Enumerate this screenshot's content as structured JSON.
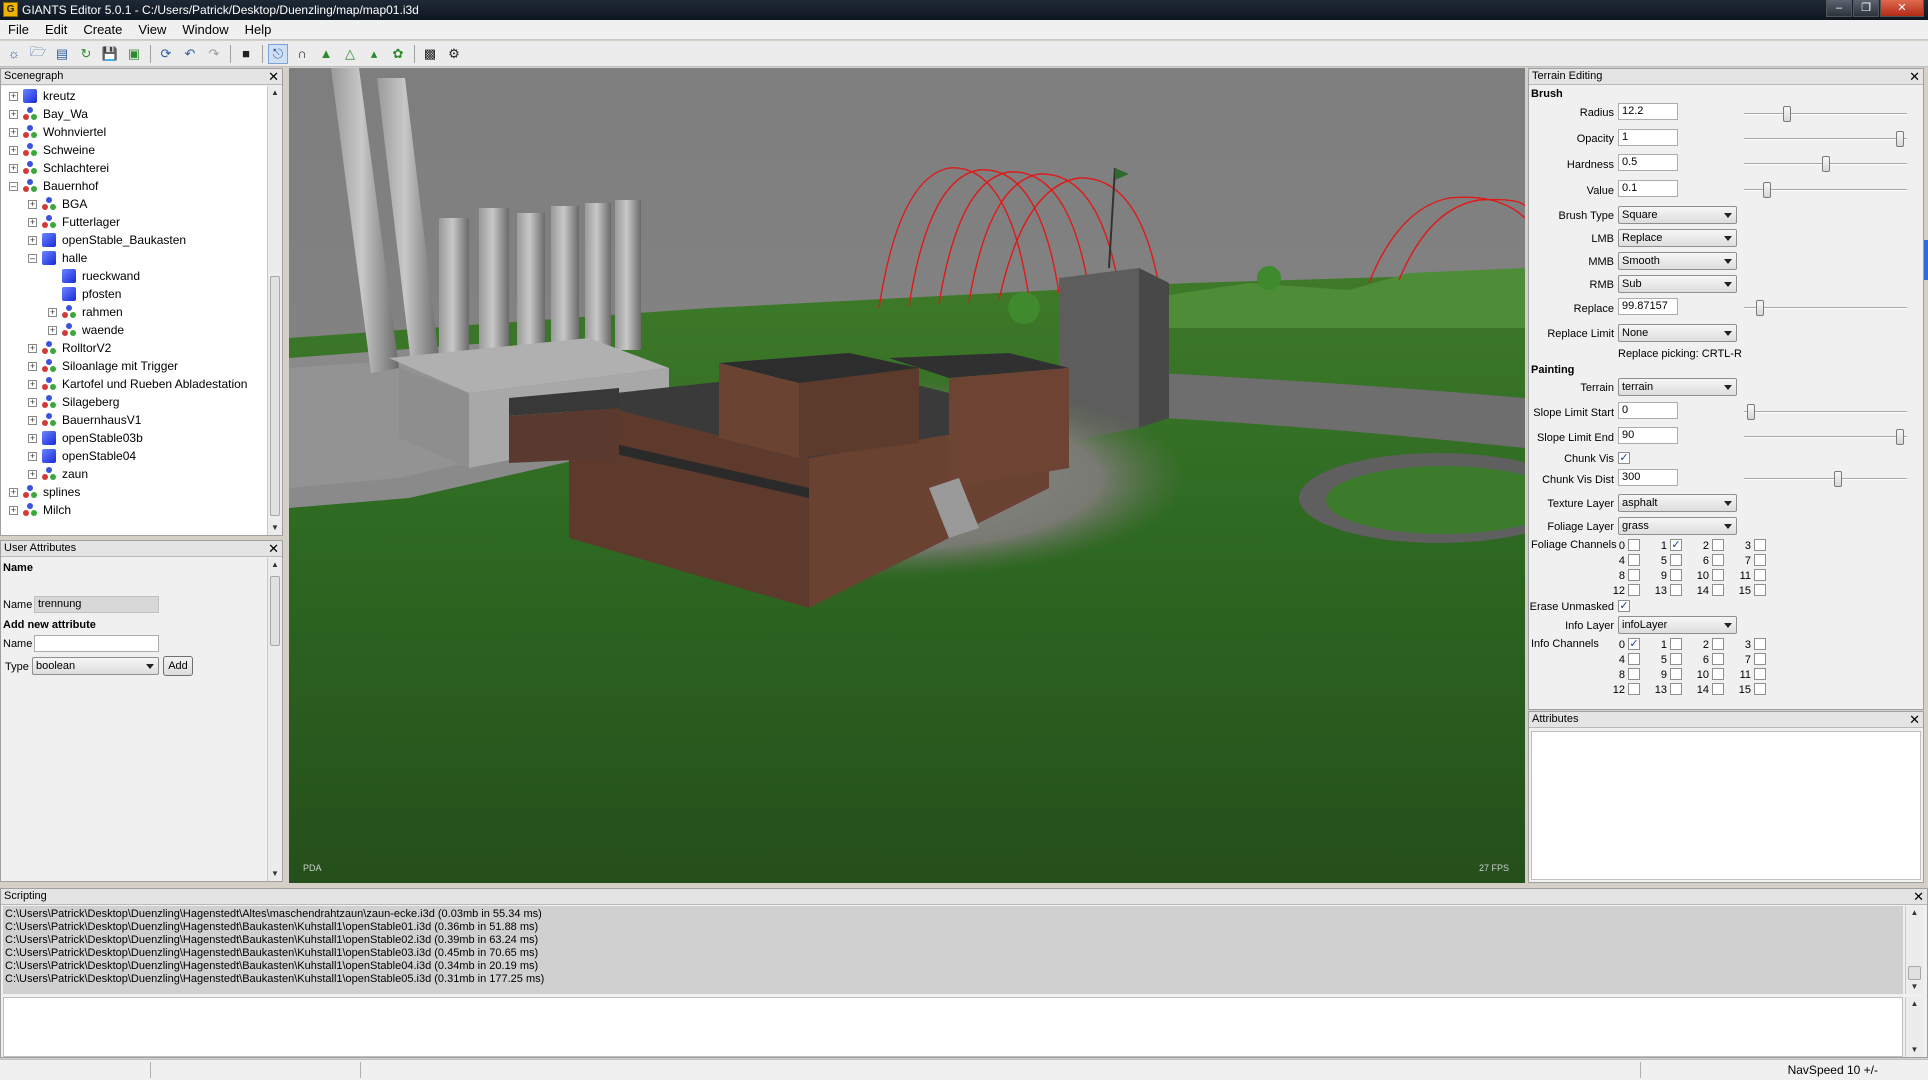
{
  "window": {
    "title": "GIANTS Editor 5.0.1 - C:/Users/Patrick/Desktop/Duenzling/map/map01.i3d"
  },
  "menu": [
    "File",
    "Edit",
    "Create",
    "View",
    "Window",
    "Help"
  ],
  "scenegraph": {
    "title": "Scenegraph",
    "nodes": [
      {
        "label": "kreutz",
        "icon": "cube"
      },
      {
        "label": "Bay_Wa",
        "icon": "transformgroup"
      },
      {
        "label": "Wohnviertel",
        "icon": "transformgroup"
      },
      {
        "label": "Schweine",
        "icon": "transformgroup"
      },
      {
        "label": "Schlachterei",
        "icon": "transformgroup"
      },
      {
        "label": "Bauernhof",
        "icon": "transformgroup"
      },
      {
        "label": "BGA",
        "icon": "transformgroup"
      },
      {
        "label": "Futterlager",
        "icon": "transformgroup"
      },
      {
        "label": "openStable_Baukasten",
        "icon": "cube"
      },
      {
        "label": "halle",
        "icon": "cube"
      },
      {
        "label": "rueckwand",
        "icon": "cube"
      },
      {
        "label": "pfosten",
        "icon": "cube"
      },
      {
        "label": "rahmen",
        "icon": "transformgroup"
      },
      {
        "label": "waende",
        "icon": "transformgroup"
      },
      {
        "label": "RolltorV2",
        "icon": "transformgroup"
      },
      {
        "label": "Siloanlage mit Trigger",
        "icon": "transformgroup"
      },
      {
        "label": "Kartofel und Rueben Abladestation",
        "icon": "transformgroup"
      },
      {
        "label": "Silageberg",
        "icon": "transformgroup"
      },
      {
        "label": "BauernhausV1",
        "icon": "transformgroup"
      },
      {
        "label": "openStable03b",
        "icon": "cube"
      },
      {
        "label": "openStable04",
        "icon": "cube"
      },
      {
        "label": "zaun",
        "icon": "transformgroup"
      },
      {
        "label": "splines",
        "icon": "transformgroup"
      },
      {
        "label": "Milch",
        "icon": "transformgroup"
      }
    ]
  },
  "user_attributes": {
    "title": "User Attributes",
    "name_heading": "Name",
    "name_label": "Name",
    "name_value": "trennung",
    "add_heading": "Add new attribute",
    "new_name_label": "Name",
    "new_name_value": "",
    "type_label": "Type",
    "type_value": "boolean",
    "add_button": "Add"
  },
  "viewport": {
    "camera": "PDA",
    "fps": "27 FPS"
  },
  "terrain_editing": {
    "title": "Terrain Editing",
    "brush_heading": "Brush",
    "radius_label": "Radius",
    "radius_value": "12.2",
    "radius_level": 0.25,
    "opacity_label": "Opacity",
    "opacity_value": "1",
    "opacity_level": 0.98,
    "hardness_label": "Hardness",
    "hardness_value": "0.5",
    "hardness_level": 0.5,
    "value_label": "Value",
    "value_value": "0.1",
    "value_level": 0.12,
    "brush_type_label": "Brush Type",
    "brush_type_value": "Square",
    "lmb_label": "LMB",
    "lmb_value": "Replace",
    "mmb_label": "MMB",
    "mmb_value": "Smooth",
    "rmb_label": "RMB",
    "rmb_value": "Sub",
    "replace_label": "Replace",
    "replace_value": "99.87157",
    "replace_level": 0.08,
    "replace_limit_label": "Replace Limit",
    "replace_limit_value": "None",
    "replace_picking": "Replace picking: CRTL-R",
    "painting_heading": "Painting",
    "terrain_label": "Terrain",
    "terrain_value": "terrain",
    "slope_start_label": "Slope Limit Start",
    "slope_start_value": "0",
    "slope_start_level": 0.02,
    "slope_end_label": "Slope Limit End",
    "slope_end_value": "90",
    "slope_end_level": 0.98,
    "chunk_vis_label": "Chunk Vis",
    "chunk_vis_checked": true,
    "chunk_vis_dist_label": "Chunk Vis Dist",
    "chunk_vis_dist_value": "300",
    "chunk_vis_dist_level": 0.58,
    "texture_layer_label": "Texture Layer",
    "texture_layer_value": "asphalt",
    "foliage_layer_label": "Foliage Layer",
    "foliage_layer_value": "grass",
    "foliage_channels_label": "Foliage Channels",
    "foliage_channels_checked": [
      1
    ],
    "erase_unmasked_label": "Erase Unmasked",
    "erase_unmasked_checked": true,
    "info_layer_label": "Info Layer",
    "info_layer_value": "infoLayer",
    "info_channels_label": "Info Channels",
    "info_channels_checked": [
      0
    ],
    "channel_numbers": [
      "0",
      "1",
      "2",
      "3",
      "4",
      "5",
      "6",
      "7",
      "8",
      "9",
      "10",
      "11",
      "12",
      "13",
      "14",
      "15"
    ]
  },
  "attributes_panel": {
    "title": "Attributes"
  },
  "scripting": {
    "title": "Scripting",
    "lines": [
      "C:\\Users\\Patrick\\Desktop\\Duenzling\\Hagenstedt\\Altes\\maschendrahtzaun\\zaun-ecke.i3d (0.03mb in 55.34 ms)",
      "C:\\Users\\Patrick\\Desktop\\Duenzling\\Hagenstedt\\Baukasten\\Kuhstall1\\openStable01.i3d (0.36mb in 51.88 ms)",
      "C:\\Users\\Patrick\\Desktop\\Duenzling\\Hagenstedt\\Baukasten\\Kuhstall1\\openStable02.i3d (0.39mb in 63.24 ms)",
      "C:\\Users\\Patrick\\Desktop\\Duenzling\\Hagenstedt\\Baukasten\\Kuhstall1\\openStable03.i3d (0.45mb in 70.65 ms)",
      "C:\\Users\\Patrick\\Desktop\\Duenzling\\Hagenstedt\\Baukasten\\Kuhstall1\\openStable04.i3d (0.34mb in 20.19 ms)",
      "C:\\Users\\Patrick\\Desktop\\Duenzling\\Hagenstedt\\Baukasten\\Kuhstall1\\openStable05.i3d (0.31mb in 177.25 ms)"
    ]
  },
  "status": {
    "navspeed": "NavSpeed 10 +/-"
  }
}
